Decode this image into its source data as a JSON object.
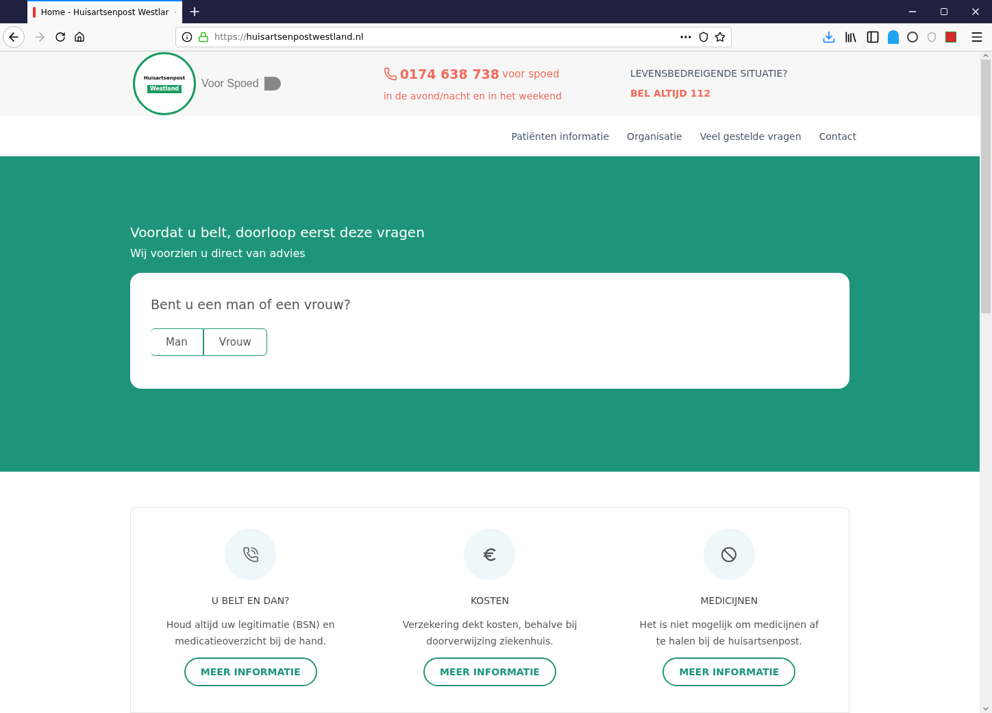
{
  "browser": {
    "tab_title": "Home - Huisartsenpost Westlar",
    "url_scheme": "https://",
    "url_host": "huisartsenpostwestland.nl"
  },
  "header": {
    "logo_top": "Huisartsenpost",
    "logo_bottom": "Westland",
    "tagline": "Voor Spoed",
    "phone": "0174 638 738",
    "phone_suffix": "voor spoed",
    "phone_hours": "in de avond/nacht en in het weekend",
    "alert_title": "LEVENSBEDREIGENDE SITUATIE?",
    "alert_action": "BEL ALTIJD 112"
  },
  "nav": [
    "Patiënten informatie",
    "Organisatie",
    "Veel gestelde vragen",
    "Contact"
  ],
  "hero": {
    "title": "Voordat u belt, doorloop eerst deze vragen",
    "subtitle": "Wij voorzien u direct van advies",
    "question": "Bent u een man of een vrouw?",
    "options": [
      {
        "label": "Man",
        "selected": false
      },
      {
        "label": "Vrouw",
        "selected": false
      }
    ]
  },
  "features": [
    {
      "kind": "phone",
      "title": "U BELT EN DAN?",
      "text": "Houd altijd uw legitimatie (BSN) en medicatieoverzicht bij de hand.",
      "button": "MEER INFORMATIE"
    },
    {
      "kind": "euro",
      "title": "KOSTEN",
      "text": "Verzekering dekt kosten, behalve bij doorverwijzing ziekenhuis.",
      "button": "MEER INFORMATIE"
    },
    {
      "kind": "ban",
      "title": "MEDICIJNEN",
      "text": "Het is niet mogelijk om medicijnen af te halen bij de huisartsenpost.",
      "button": "MEER INFORMATIE"
    }
  ]
}
